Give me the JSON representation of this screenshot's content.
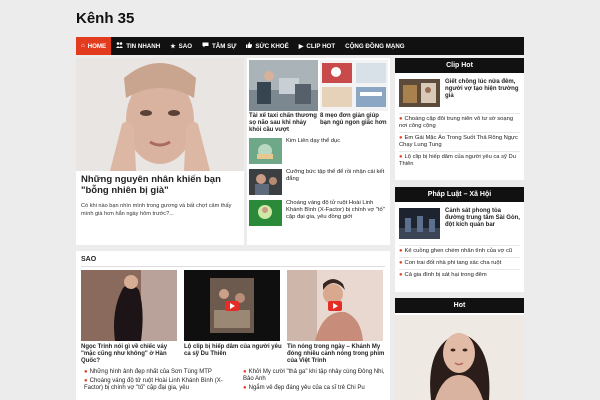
{
  "site": {
    "title": "Kênh 35"
  },
  "nav": [
    {
      "label": "HOME",
      "icon": "home-icon",
      "glyph": "⌂"
    },
    {
      "label": "TIN NHANH",
      "icon": "users-icon",
      "glyph": "👥"
    },
    {
      "label": "SAO",
      "icon": "star-icon",
      "glyph": "★"
    },
    {
      "label": "TÂM SỰ",
      "icon": "chat-icon",
      "glyph": "💬"
    },
    {
      "label": "SỨC KHOẺ",
      "icon": "thumbs-up-icon",
      "glyph": "👍"
    },
    {
      "label": "CLIP HOT",
      "icon": "video-icon",
      "glyph": "▶"
    },
    {
      "label": "CỘNG ĐỒNG MẠNG",
      "icon": "",
      "glyph": ""
    }
  ],
  "featured": {
    "title": "Những nguyên nhân khiến bạn \"bỗng nhiên bị già\"",
    "desc": "Có khi nào bạn nhìn mình trong gương và bất chợt cảm thấy mình già hơn hẳn ngày hôm trước?..."
  },
  "right_panel": {
    "top_cards": [
      {
        "title": "Tài xế taxi chấn thương sọ não sau khi nhảy khỏi cầu vượt"
      },
      {
        "title": "8 mẹo đơn giản giúp bạn ngủ ngon giấc hơn"
      }
    ],
    "list": [
      {
        "title": "Kim Liên dạy thể dục"
      },
      {
        "title": "Cưỡng bức tập thể để rồi nhận cái kết đắng"
      },
      {
        "title": "Choáng váng độ tử ruột Hoài Linh Khánh Bình (X-Factor) bị chính vợ \"tố\" cặp đại gia, yêu đồng giới"
      }
    ]
  },
  "sao": {
    "heading": "SAO",
    "cards": [
      {
        "title": "Ngọc Trinh nói gì về chiếc váy \"mặc cũng như không\" ở Hàn Quốc?"
      },
      {
        "title": "Lộ clip bị hiếp dâm của người yêu ca sỹ Du Thiên"
      },
      {
        "title": "Tin nóng trong ngày – Khánh My đóng nhiều cảnh nóng trong phim của Việt Trinh"
      }
    ],
    "list_left": [
      "Những hình ảnh đẹp nhất của Sơn Tùng MTP",
      "Choáng váng độ tử ruột Hoài Linh Khánh Bình (X-Factor) bị chính vợ \"tố\" cặp đại gia, yêu"
    ],
    "list_right": [
      "Khởi My cười \"thả ga\" khi tập nhảy cùng Đông Nhi, Bảo Anh",
      "Ngắm vẻ đẹp đáng yêu của ca sĩ trẻ Chi Pu"
    ]
  },
  "sidebar": {
    "clip_hot": {
      "heading": "Clip Hot",
      "feature_title": "Giết chồng lúc nửa đêm, người vợ tạo hiện trường giả",
      "list": [
        "Choáng cặp đôi trung niên vô tư sờ soạng nơi công cộng",
        "Em Gái Mặc Áo Trong Suốt Thả Rông Ngực Chạy Lung Tung",
        "Lộ clip bị hiếp dâm của người yêu ca sỹ Du Thiên"
      ]
    },
    "phap_luat": {
      "heading": "Pháp Luật – Xã Hội",
      "feature_title": "Cảnh sát phong tỏa đường trung tâm Sài Gòn, đột kích quán bar",
      "list": [
        "Kẻ cuồng ghen chém nhân tình của vợ cũ",
        "Con trai đốt nhà phi tang xác cha ruột",
        "Cả gia đình bị sát hại trong đêm"
      ]
    },
    "hot": {
      "heading": "Hot"
    }
  },
  "colors": {
    "accent": "#e23b1e",
    "nav_bg": "#111111",
    "page_bg": "#ececec"
  }
}
